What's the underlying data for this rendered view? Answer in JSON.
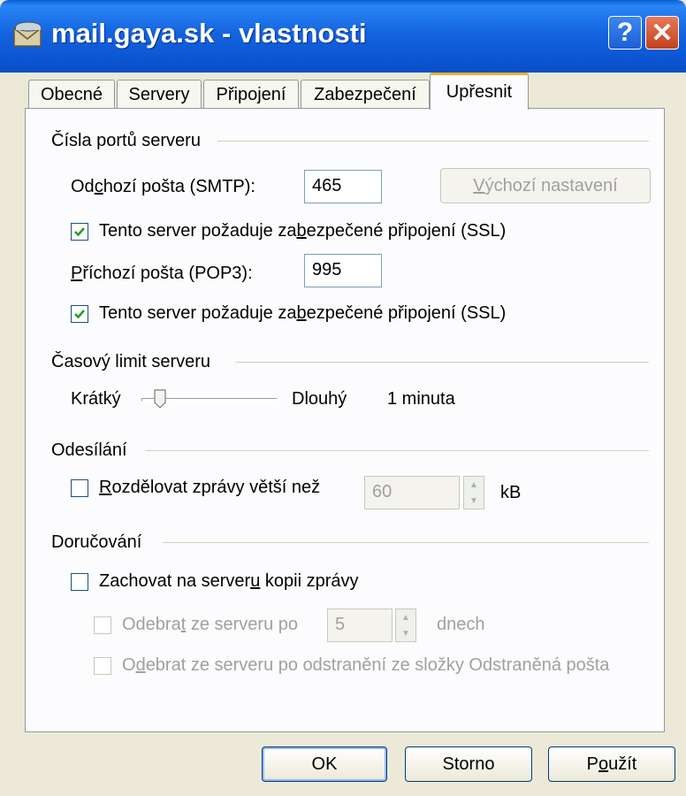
{
  "window": {
    "title": "mail.gaya.sk - vlastnosti",
    "help_label": "?",
    "close_label": "✕"
  },
  "tabs": [
    {
      "label": "Obecné",
      "active": false
    },
    {
      "label": "Servery",
      "active": false
    },
    {
      "label": "Připojení",
      "active": false
    },
    {
      "label": "Zabezpečení",
      "active": false
    },
    {
      "label": "Upřesnit",
      "active": true
    }
  ],
  "ports": {
    "group_label": "Čísla portů serveru",
    "smtp_label": "Odchozí pošta (SMTP):",
    "smtp_value": "465",
    "default_button": "Výchozí nastavení",
    "ssl_smtp_label": "Tento server požaduje zabezpečené připojení (SSL)",
    "ssl_smtp_checked": true,
    "pop3_label": "Příchozí pošta (POP3):",
    "pop3_value": "995",
    "ssl_pop3_label": "Tento server požaduje zabezpečené připojení (SSL)",
    "ssl_pop3_checked": true
  },
  "timeout": {
    "group_label": "Časový limit serveru",
    "short_label": "Krátký",
    "long_label": "Dlouhý",
    "value_text": "1 minuta",
    "slider_level": 0.1
  },
  "sending": {
    "group_label": "Odesílání",
    "split_label": "Rozdělovat zprávy větší než",
    "split_checked": false,
    "split_value": "60",
    "unit": "kB"
  },
  "delivery": {
    "group_label": "Doručování",
    "keep_copy_label": "Zachovat na serveru kopii zprávy",
    "keep_copy_checked": false,
    "remove_after_label": "Odebrat ze serveru po",
    "remove_after_value": "5",
    "days_label": "dnech",
    "remove_deleted_label": "Odebrat ze serveru po odstranění ze složky Odstraněná pošta"
  },
  "buttons": {
    "ok": "OK",
    "cancel": "Storno",
    "apply": "Použít"
  },
  "colors": {
    "titlebar": "#0a5fd8",
    "window_bg": "#ece9d8",
    "panel_bg": "#fcfcfe",
    "checkmark": "#21a121",
    "active_tab_accent": "#f0b030"
  }
}
